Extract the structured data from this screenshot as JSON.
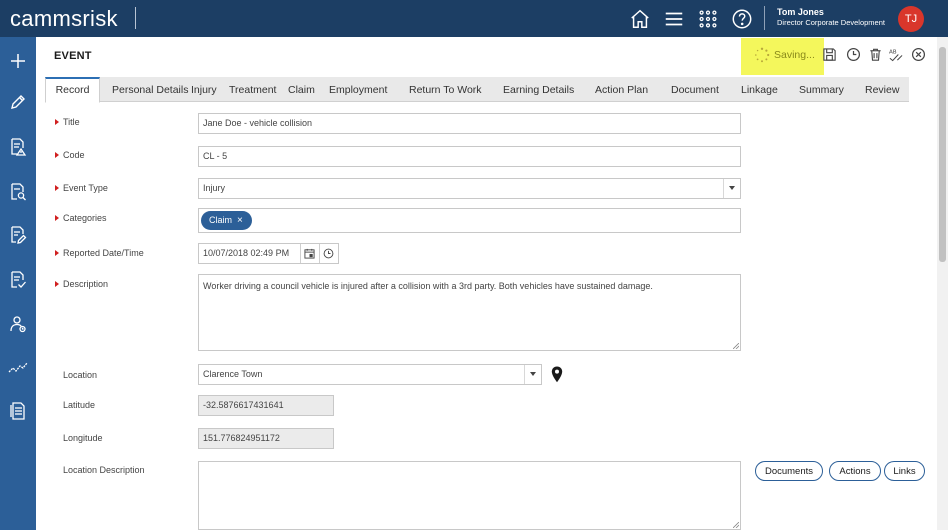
{
  "app": {
    "logo": "cammsrisk",
    "user_name": "Tom Jones",
    "user_role": "Director Corporate Development",
    "user_initials": "TJ"
  },
  "topbar_icons": [
    "home-icon",
    "menu-icon",
    "apps-grid-icon",
    "help-icon"
  ],
  "sidebar_icons": [
    "plus-icon",
    "pencil-icon",
    "document-warning-icon",
    "document-search-icon",
    "document-edit-icon",
    "document-check-icon",
    "people-icon",
    "trend-line-icon",
    "report-icon"
  ],
  "header": {
    "title": "EVENT",
    "saving_text": "Saving..."
  },
  "tabs": [
    "Record",
    "Personal Details",
    "Injury",
    "Treatment",
    "Claim",
    "Employment",
    "Return To Work",
    "Earning Details",
    "Action Plan",
    "Document",
    "Linkage",
    "Summary",
    "Review"
  ],
  "form": {
    "title": {
      "label": "Title",
      "value": "Jane Doe - vehicle collision"
    },
    "code": {
      "label": "Code",
      "value": "CL - 5"
    },
    "event_type": {
      "label": "Event Type",
      "value": "Injury"
    },
    "categories": {
      "label": "Categories",
      "chip": "Claim",
      "chip_remove": "×"
    },
    "reported": {
      "label": "Reported Date/Time",
      "value": "10/07/2018 02:49 PM"
    },
    "description": {
      "label": "Description",
      "value": "Worker driving a council vehicle is injured after a collision with a 3rd party.  Both vehicles have sustained damage."
    },
    "location": {
      "label": "Location",
      "value": "Clarence Town"
    },
    "latitude": {
      "label": "Latitude",
      "value": "-32.5876617431641"
    },
    "longitude": {
      "label": "Longitude",
      "value": "151.776824951172"
    },
    "location_description": {
      "label": "Location Description",
      "value": ""
    }
  },
  "buttons": {
    "documents": "Documents",
    "actions": "Actions",
    "links": "Links"
  },
  "colors": {
    "topbar": "#1c3e64",
    "sidebar": "#2c5f98",
    "accent": "#2c6fb4",
    "saving_highlight": "#f4f75c",
    "avatar": "#d9362b",
    "required": "#d02020"
  }
}
